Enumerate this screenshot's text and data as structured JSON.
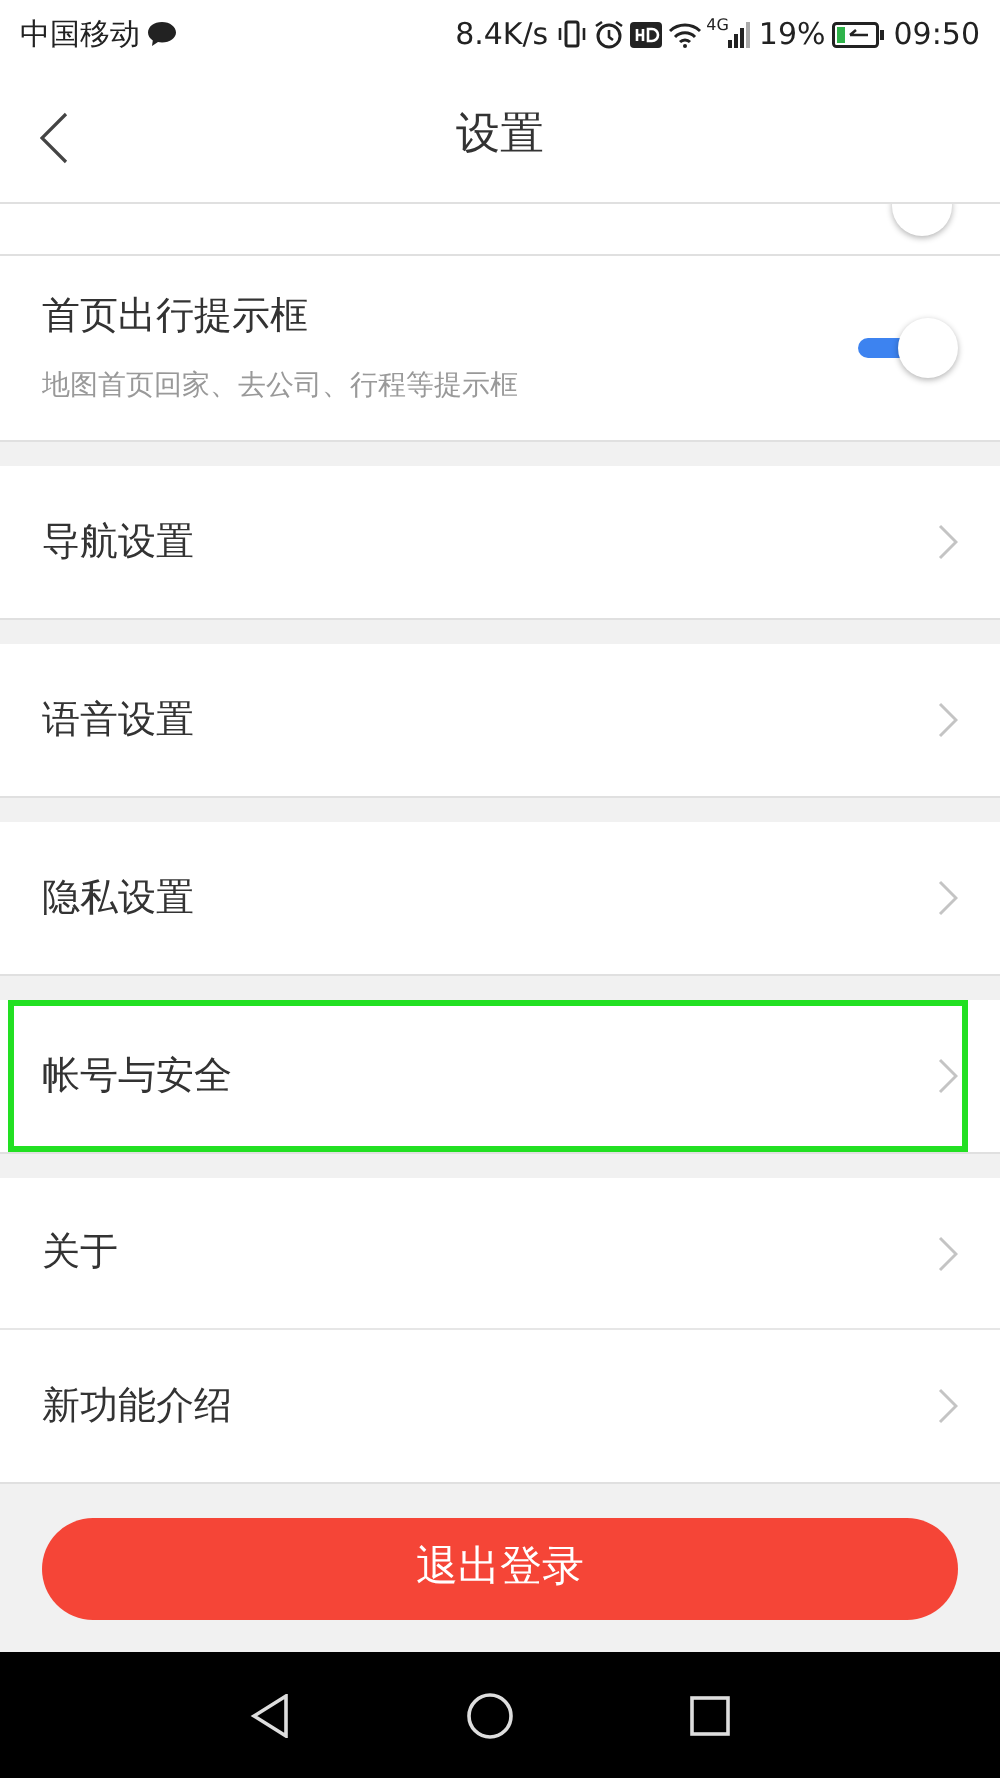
{
  "status_bar": {
    "carrier": "中国移动",
    "speed": "8.4K/s",
    "network": "4G",
    "battery": "19%",
    "time": "09:50"
  },
  "header": {
    "title": "设置"
  },
  "groups": [
    {
      "items": [
        {
          "kind": "toggle",
          "label": "首页出行提示框",
          "description": "地图首页回家、去公司、行程等提示框",
          "on": true,
          "highlighted": false
        }
      ]
    },
    {
      "items": [
        {
          "kind": "link",
          "label": "导航设置",
          "highlighted": false
        }
      ]
    },
    {
      "items": [
        {
          "kind": "link",
          "label": "语音设置",
          "highlighted": false
        }
      ]
    },
    {
      "items": [
        {
          "kind": "link",
          "label": "隐私设置",
          "highlighted": false
        }
      ]
    },
    {
      "items": [
        {
          "kind": "link",
          "label": "帐号与安全",
          "highlighted": true
        }
      ]
    },
    {
      "items": [
        {
          "kind": "link",
          "label": "关于",
          "highlighted": false
        },
        {
          "kind": "link",
          "label": "新功能介绍",
          "highlighted": false
        }
      ]
    }
  ],
  "logout_button": "退出登录"
}
